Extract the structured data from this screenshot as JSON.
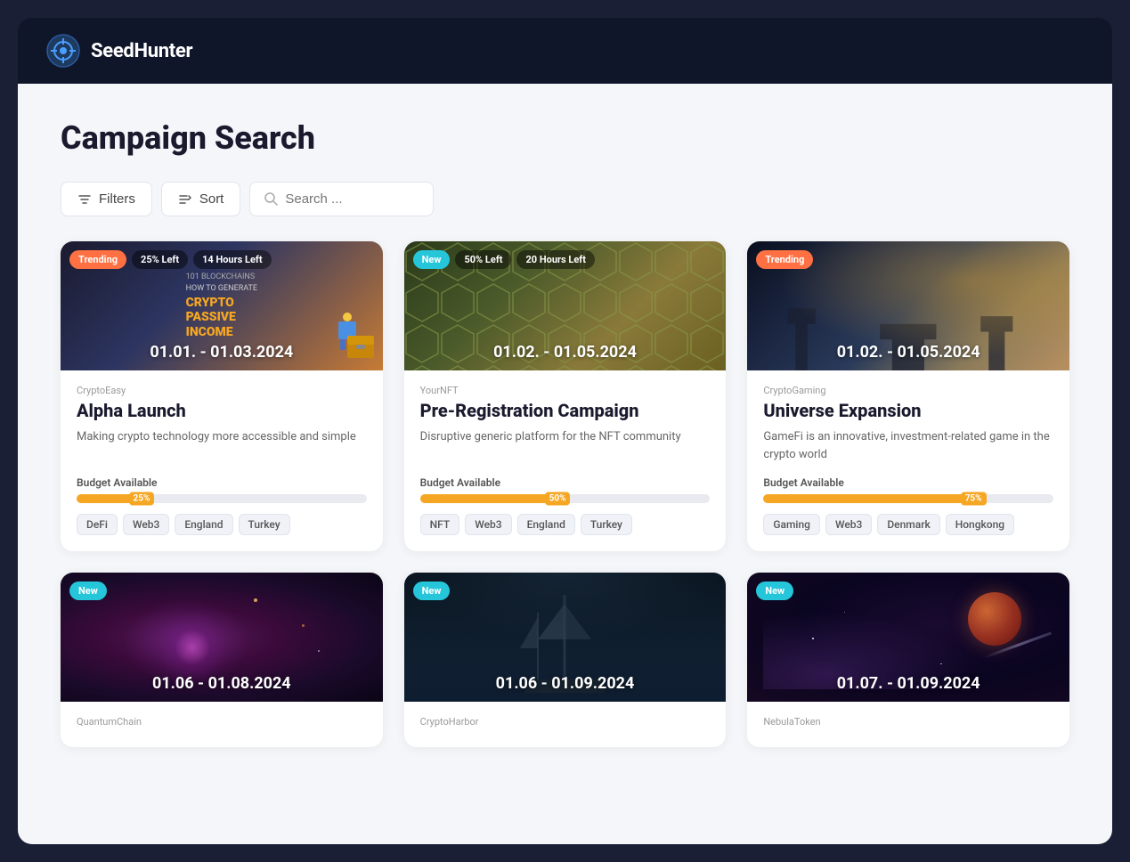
{
  "app": {
    "name": "SeedHunter"
  },
  "page": {
    "title": "Campaign Search"
  },
  "toolbar": {
    "filters_label": "Filters",
    "sort_label": "Sort",
    "search_placeholder": "Search ..."
  },
  "campaigns": [
    {
      "id": 1,
      "brand": "CryptoEasy",
      "title": "Alpha Launch",
      "description": "Making crypto technology more accessible and simple",
      "date_range": "01.01. - 01.03.2024",
      "badges": [
        {
          "label": "Trending",
          "type": "trending"
        },
        {
          "label": "25% Left",
          "type": "pct"
        },
        {
          "label": "14 Hours Left",
          "type": "time"
        }
      ],
      "budget_pct": 25,
      "tags": [
        "DeFi",
        "Web3",
        "England",
        "Turkey"
      ],
      "bg_class": "bg-crypto1"
    },
    {
      "id": 2,
      "brand": "YourNFT",
      "title": "Pre-Registration Campaign",
      "description": "Disruptive generic platform for the NFT community",
      "date_range": "01.02. - 01.05.2024",
      "badges": [
        {
          "label": "New",
          "type": "new"
        },
        {
          "label": "50% Left",
          "type": "pct"
        },
        {
          "label": "20 Hours Left",
          "type": "time"
        }
      ],
      "budget_pct": 50,
      "tags": [
        "NFT",
        "Web3",
        "England",
        "Turkey"
      ],
      "bg_class": "bg-crypto2"
    },
    {
      "id": 3,
      "brand": "CryptoGaming",
      "title": "Universe Expansion",
      "description": "GameFi is an innovative, investment-related game in the crypto world",
      "date_range": "01.02. - 01.05.2024",
      "badges": [
        {
          "label": "Trending",
          "type": "trending"
        }
      ],
      "budget_pct": 75,
      "tags": [
        "Gaming",
        "Web3",
        "Denmark",
        "Hongkong"
      ],
      "bg_class": "bg-crypto3"
    },
    {
      "id": 4,
      "brand": "QuantumChain",
      "title": "",
      "description": "",
      "date_range": "01.06 - 01.08.2024",
      "badges": [
        {
          "label": "New",
          "type": "new"
        }
      ],
      "budget_pct": 0,
      "tags": [],
      "bg_class": "bg-crypto4"
    },
    {
      "id": 5,
      "brand": "CryptoHarbor",
      "title": "",
      "description": "",
      "date_range": "01.06 - 01.09.2024",
      "badges": [
        {
          "label": "New",
          "type": "new"
        }
      ],
      "budget_pct": 0,
      "tags": [],
      "bg_class": "bg-crypto5"
    },
    {
      "id": 6,
      "brand": "NebulaToken",
      "title": "",
      "description": "",
      "date_range": "01.07. - 01.09.2024",
      "badges": [
        {
          "label": "New",
          "type": "new"
        }
      ],
      "budget_pct": 0,
      "tags": [],
      "bg_class": "bg-crypto6"
    }
  ]
}
